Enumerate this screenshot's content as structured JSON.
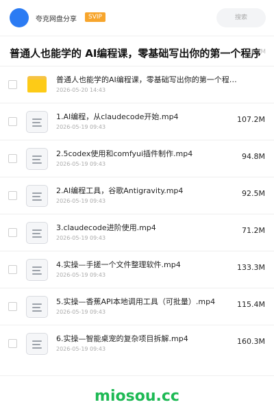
{
  "header": {
    "uploader": "夸克网盘分享",
    "badge": "SVIP",
    "search_placeholder": "搜索"
  },
  "page": {
    "title": "普通人也能学的 AI编程课，零基础写出你的第一个程序",
    "title_size": "1.3M"
  },
  "files": [
    {
      "type": "folder",
      "name": "普通人也能学的AI编程课，零基础写出你的第一个程序…",
      "date": "2026-05-20 14:43",
      "size": ""
    },
    {
      "type": "video",
      "name": "1.AI编程，从claudecode开始.mp4",
      "date": "2026-05-19 09:43",
      "size": "107.2M"
    },
    {
      "type": "video",
      "name": "2.5codex使用和comfyui插件制作.mp4",
      "date": "2026-05-19 09:43",
      "size": "94.8M"
    },
    {
      "type": "video",
      "name": "2.AI编程工具，谷歌Antigravity.mp4",
      "date": "2026-05-19 09:43",
      "size": "92.5M"
    },
    {
      "type": "video",
      "name": "3.claudecode进阶使用.mp4",
      "date": "2026-05-19 09:43",
      "size": "71.2M"
    },
    {
      "type": "video",
      "name": "4.实操—手搓一个文件整理软件.mp4",
      "date": "2026-05-19 09:43",
      "size": "133.3M"
    },
    {
      "type": "video",
      "name": "5.实操—香蕉API本地调用工具（可批量）.mp4",
      "date": "2026-05-19 09:43",
      "size": "115.4M"
    },
    {
      "type": "video",
      "name": "6.实操—智能桌宠的复杂项目拆解.mp4",
      "date": "2026-05-19 09:43",
      "size": "160.3M"
    }
  ],
  "watermark": "miosou.cc",
  "colors": {
    "accent": "#2b7bf3",
    "badge": "#f7a52c",
    "folder": "#fdcb17",
    "watermark": "#1db954"
  }
}
